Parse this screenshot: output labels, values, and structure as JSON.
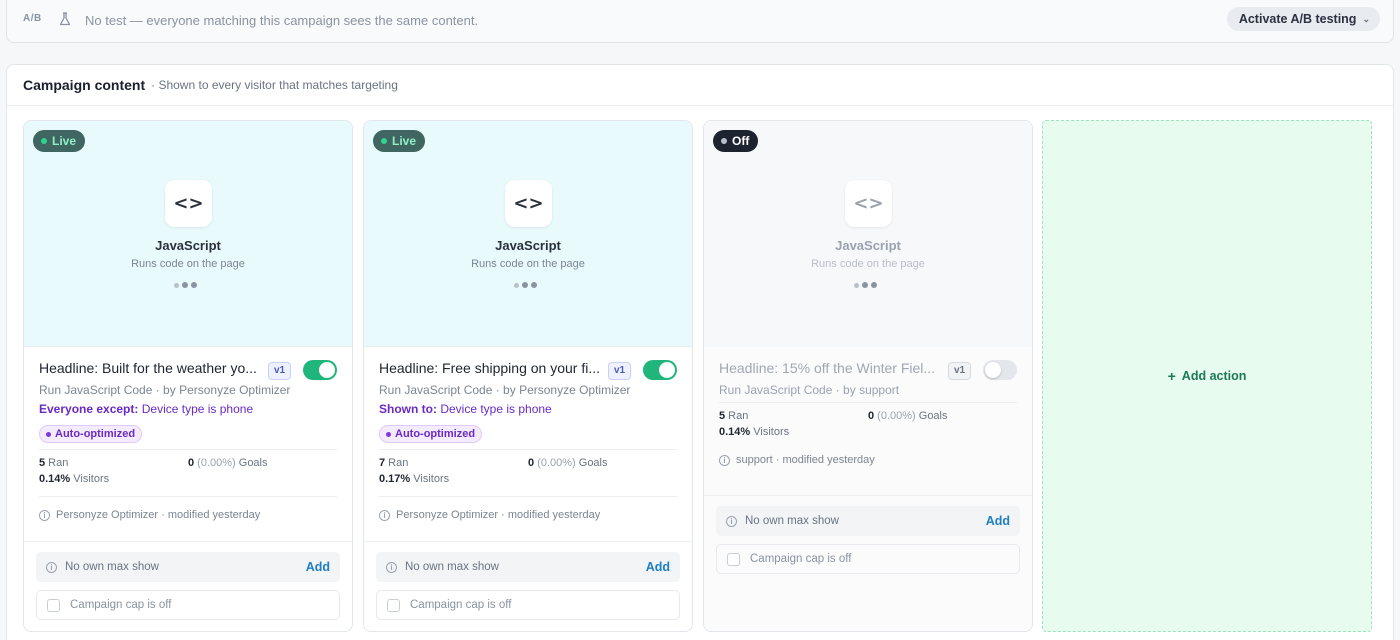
{
  "ab_bar": {
    "tag": "A/B",
    "text": "No test — everyone matching this campaign sees the same content.",
    "button": "Activate A/B testing"
  },
  "panel": {
    "title": "Campaign content",
    "subtitle": "· Shown to every visitor that matches targeting"
  },
  "cards": [
    {
      "status": "Live",
      "preview_title": "JavaScript",
      "preview_sub": "Runs code on the page",
      "headline": "Headline: Built for the weather yo...",
      "version": "v1",
      "toggle_on": true,
      "action": "Run JavaScript Code · by Personyze Optimizer",
      "target_prefix": "Everyone except:",
      "target_value": " Device type is phone",
      "auto": "Auto-optimized",
      "ran": "5",
      "ran_label": " Ran",
      "goals": "0",
      "goals_pct": " (0.00%)",
      "goals_label": " Goals",
      "visitors": "0.14%",
      "visitors_label": " Visitors",
      "meta": "Personyze Optimizer · modified yesterday",
      "maxshow": "No own max show",
      "maxshow_add": "Add",
      "cap": "Campaign cap is off"
    },
    {
      "status": "Live",
      "preview_title": "JavaScript",
      "preview_sub": "Runs code on the page",
      "headline": "Headline: Free shipping on your fi...",
      "version": "v1",
      "toggle_on": true,
      "action": "Run JavaScript Code · by Personyze Optimizer",
      "target_prefix": "Shown to:",
      "target_value": " Device type is phone",
      "auto": "Auto-optimized",
      "ran": "7",
      "ran_label": " Ran",
      "goals": "0",
      "goals_pct": " (0.00%)",
      "goals_label": " Goals",
      "visitors": "0.17%",
      "visitors_label": " Visitors",
      "meta": "Personyze Optimizer · modified yesterday",
      "maxshow": "No own max show",
      "maxshow_add": "Add",
      "cap": "Campaign cap is off"
    },
    {
      "status": "Off",
      "preview_title": "JavaScript",
      "preview_sub": "Runs code on the page",
      "headline": "Headline: 15% off the Winter Fiel...",
      "version": "v1",
      "toggle_on": false,
      "action": "Run JavaScript Code · by support",
      "ran": "5",
      "ran_label": " Ran",
      "goals": "0",
      "goals_pct": " (0.00%)",
      "goals_label": " Goals",
      "visitors": "0.14%",
      "visitors_label": " Visitors",
      "meta": "support · modified yesterday",
      "maxshow": "No own max show",
      "maxshow_add": "Add",
      "cap": "Campaign cap is off"
    }
  ],
  "add_action": "Add action",
  "colors": {
    "live_badge": "#3f6660",
    "off_badge": "#1d2430",
    "toggle_on": "#1fb57b",
    "accent_purple": "#6a2bc2",
    "link_blue": "#1f7fc4",
    "add_green": "#1c7a56"
  }
}
